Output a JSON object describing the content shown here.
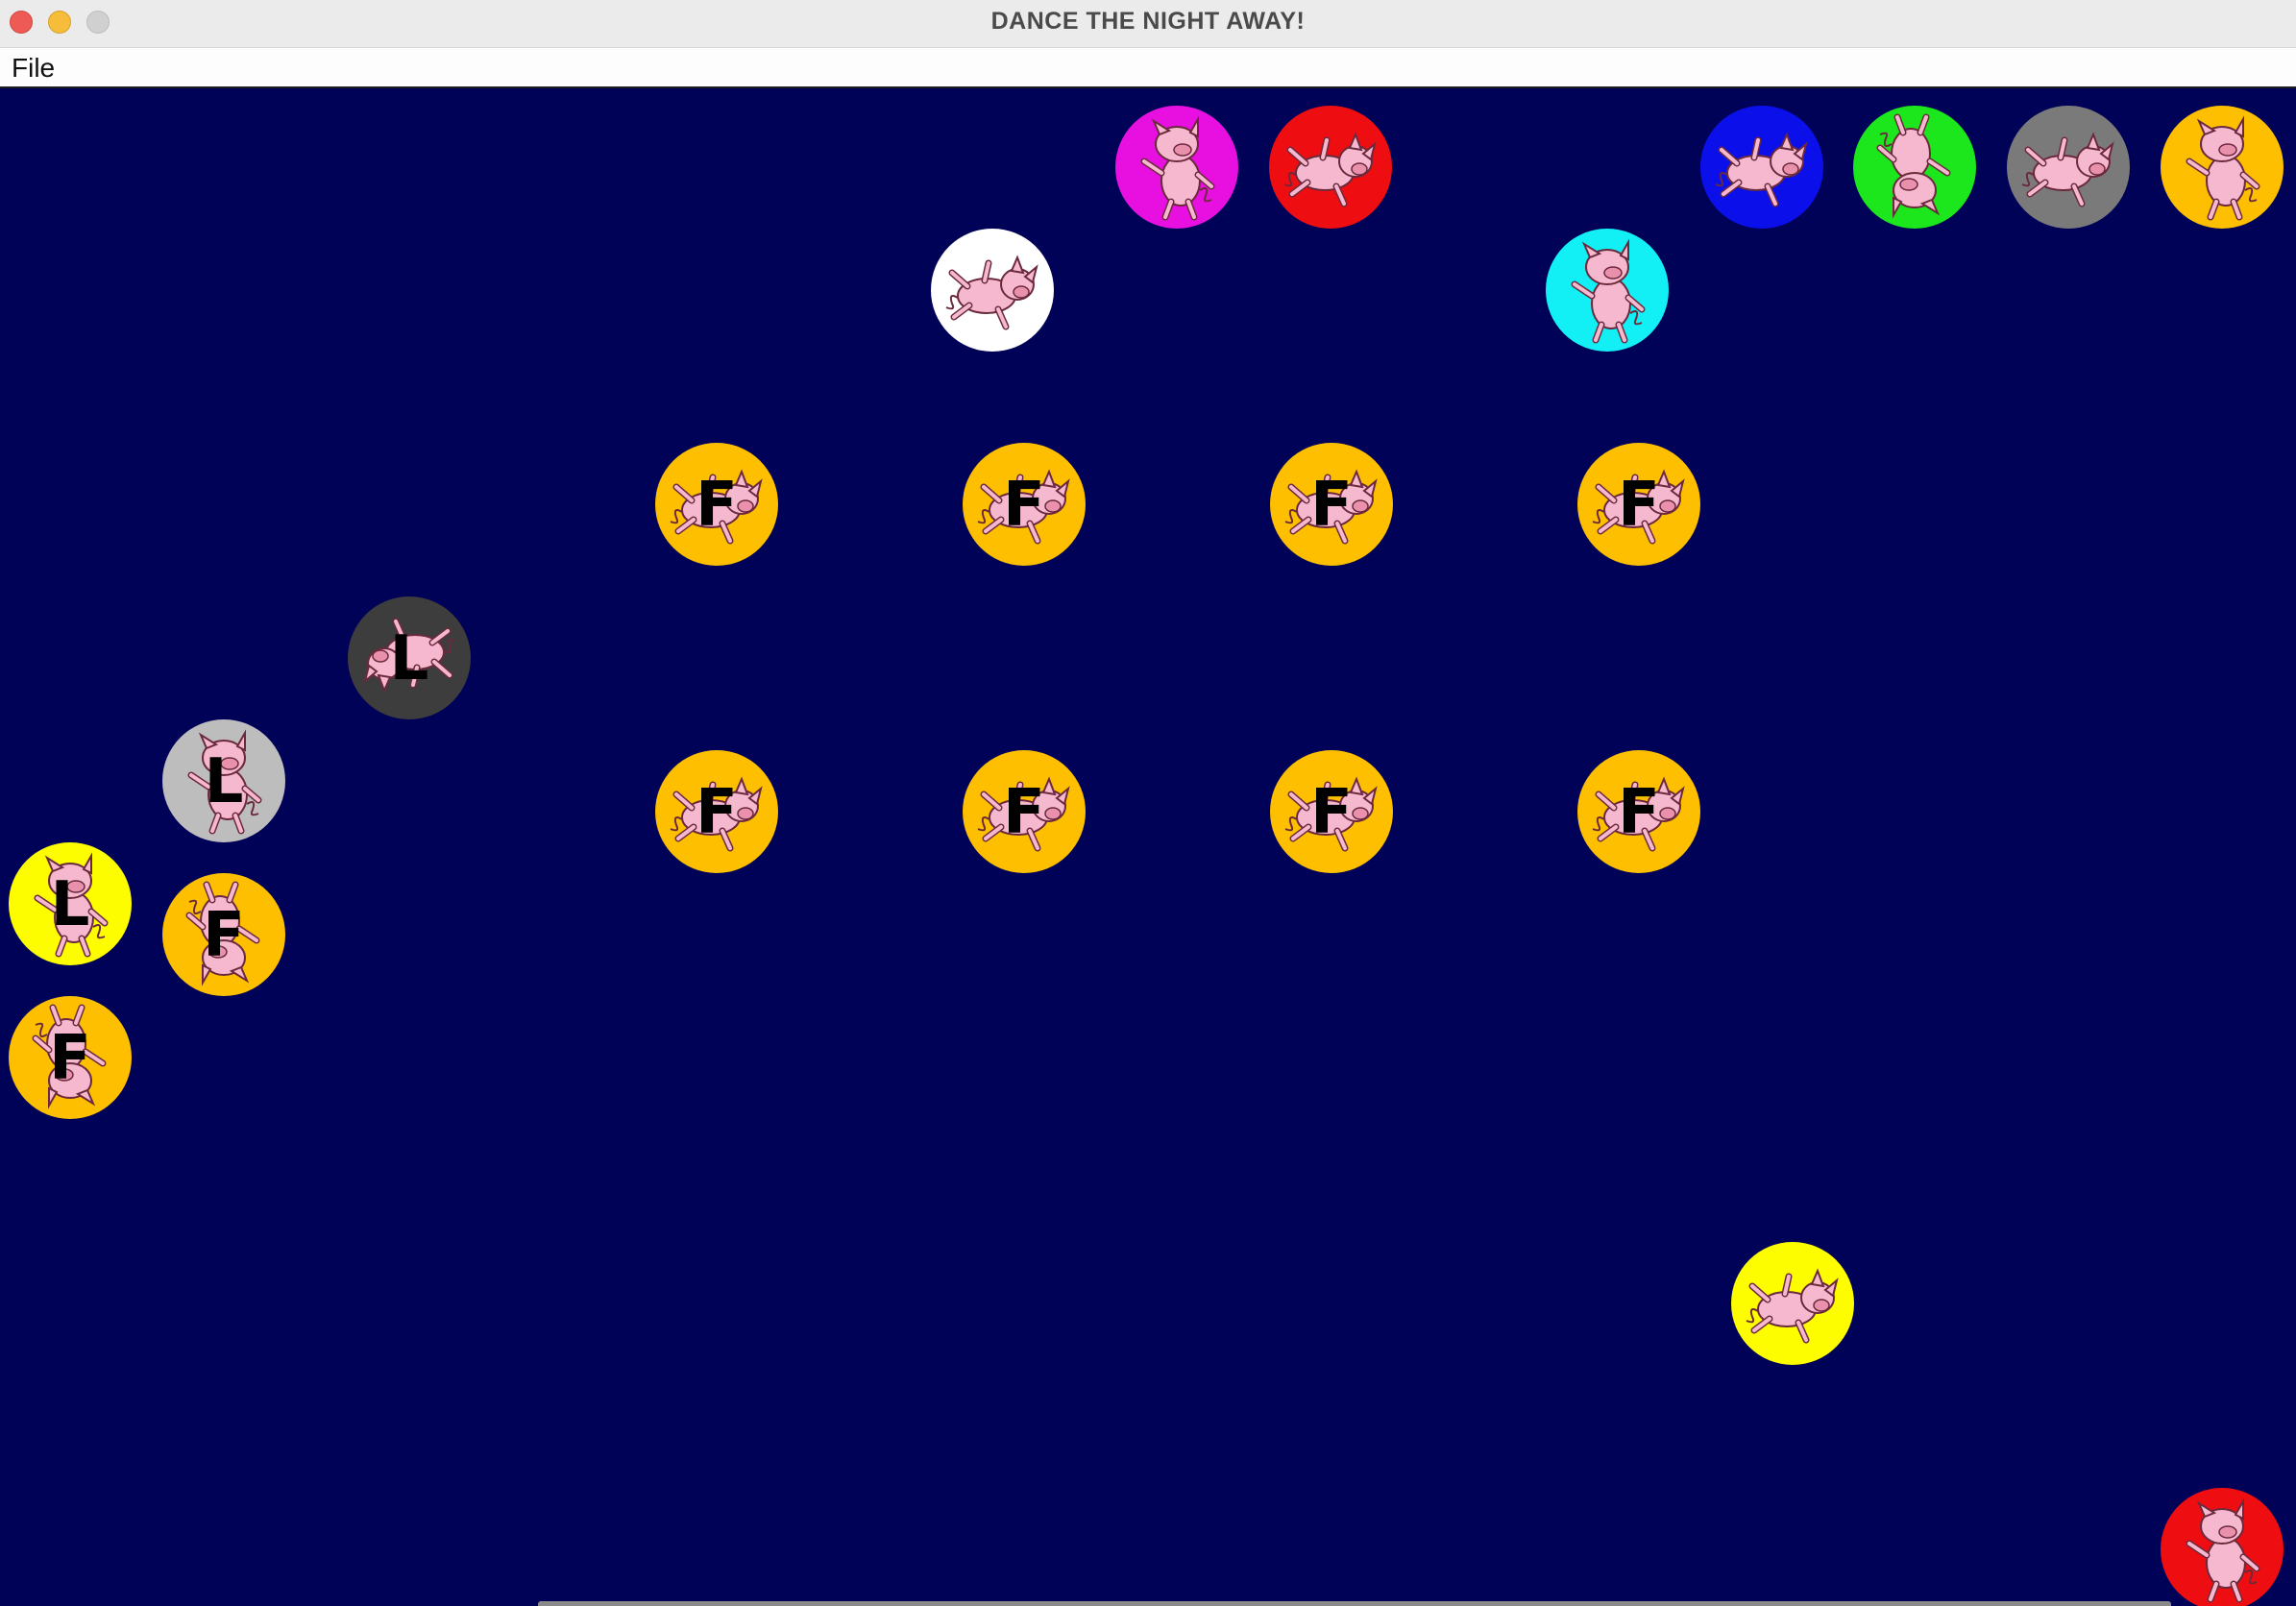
{
  "window": {
    "title": "DANCE THE NIGHT AWAY!",
    "controls": [
      "close",
      "minimize",
      "zoom"
    ]
  },
  "menubar": {
    "items": [
      {
        "label": "File"
      }
    ]
  },
  "dance_floor": {
    "background": "#000257",
    "pig_color": "#f6b8cf",
    "dancers": [
      {
        "color": "#e810e0",
        "letter": "",
        "pose": "standing"
      },
      {
        "color": "#ee0e12",
        "letter": "",
        "pose": "flying"
      },
      {
        "color": "#0b10ea",
        "letter": "",
        "pose": "flying"
      },
      {
        "color": "#1ce71c",
        "letter": "",
        "pose": "upside-down"
      },
      {
        "color": "#7a7a7a",
        "letter": "",
        "pose": "flying"
      },
      {
        "color": "#fdbf00",
        "letter": "",
        "pose": "standing"
      },
      {
        "color": "#ffffff",
        "letter": "",
        "pose": "flying"
      },
      {
        "color": "#12f0f6",
        "letter": "",
        "pose": "standing"
      },
      {
        "color": "#fdbf00",
        "letter": "F",
        "pose": "flying"
      },
      {
        "color": "#fdbf00",
        "letter": "F",
        "pose": "flying"
      },
      {
        "color": "#fdbf00",
        "letter": "F",
        "pose": "flying"
      },
      {
        "color": "#fdbf00",
        "letter": "F",
        "pose": "flying"
      },
      {
        "color": "#3d3d3d",
        "letter": "L",
        "pose": "flying-left"
      },
      {
        "color": "#bdbdbd",
        "letter": "L",
        "pose": "standing"
      },
      {
        "color": "#fdbf00",
        "letter": "F",
        "pose": "flying"
      },
      {
        "color": "#fdbf00",
        "letter": "F",
        "pose": "flying"
      },
      {
        "color": "#fdbf00",
        "letter": "F",
        "pose": "flying"
      },
      {
        "color": "#fdbf00",
        "letter": "F",
        "pose": "flying"
      },
      {
        "color": "#fdfd00",
        "letter": "L",
        "pose": "standing"
      },
      {
        "color": "#fdbf00",
        "letter": "F",
        "pose": "upside-down"
      },
      {
        "color": "#fdbf00",
        "letter": "F",
        "pose": "upside-down"
      },
      {
        "color": "#fdfd00",
        "letter": "",
        "pose": "flying"
      },
      {
        "color": "#ee0e12",
        "letter": "",
        "pose": "standing"
      }
    ]
  }
}
